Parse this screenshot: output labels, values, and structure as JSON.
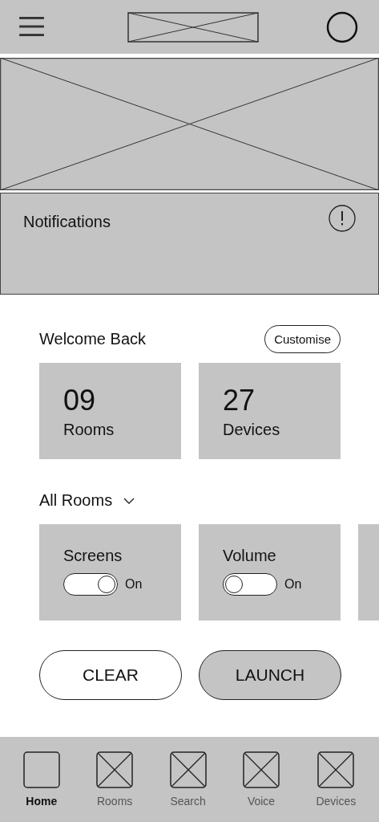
{
  "notifications": {
    "title": "Notifications"
  },
  "welcome": {
    "title": "Welcome Back",
    "action": "Customise"
  },
  "stats": [
    {
      "value": "09",
      "label": "Rooms"
    },
    {
      "value": "27",
      "label": "Devices"
    }
  ],
  "room_filter": {
    "label": "All Rooms"
  },
  "controls": [
    {
      "name": "Screens",
      "on": true,
      "state_label": "On"
    },
    {
      "name": "Volume",
      "on": false,
      "state_label": "On"
    }
  ],
  "buttons": [
    {
      "label": "CLEAR",
      "kind": "outline"
    },
    {
      "label": "LAUNCH",
      "kind": "filled"
    }
  ],
  "nav": [
    {
      "label": "Home",
      "selected": true
    },
    {
      "label": "Rooms",
      "selected": false
    },
    {
      "label": "Search",
      "selected": false
    },
    {
      "label": "Voice",
      "selected": false
    },
    {
      "label": "Devices",
      "selected": false
    }
  ]
}
